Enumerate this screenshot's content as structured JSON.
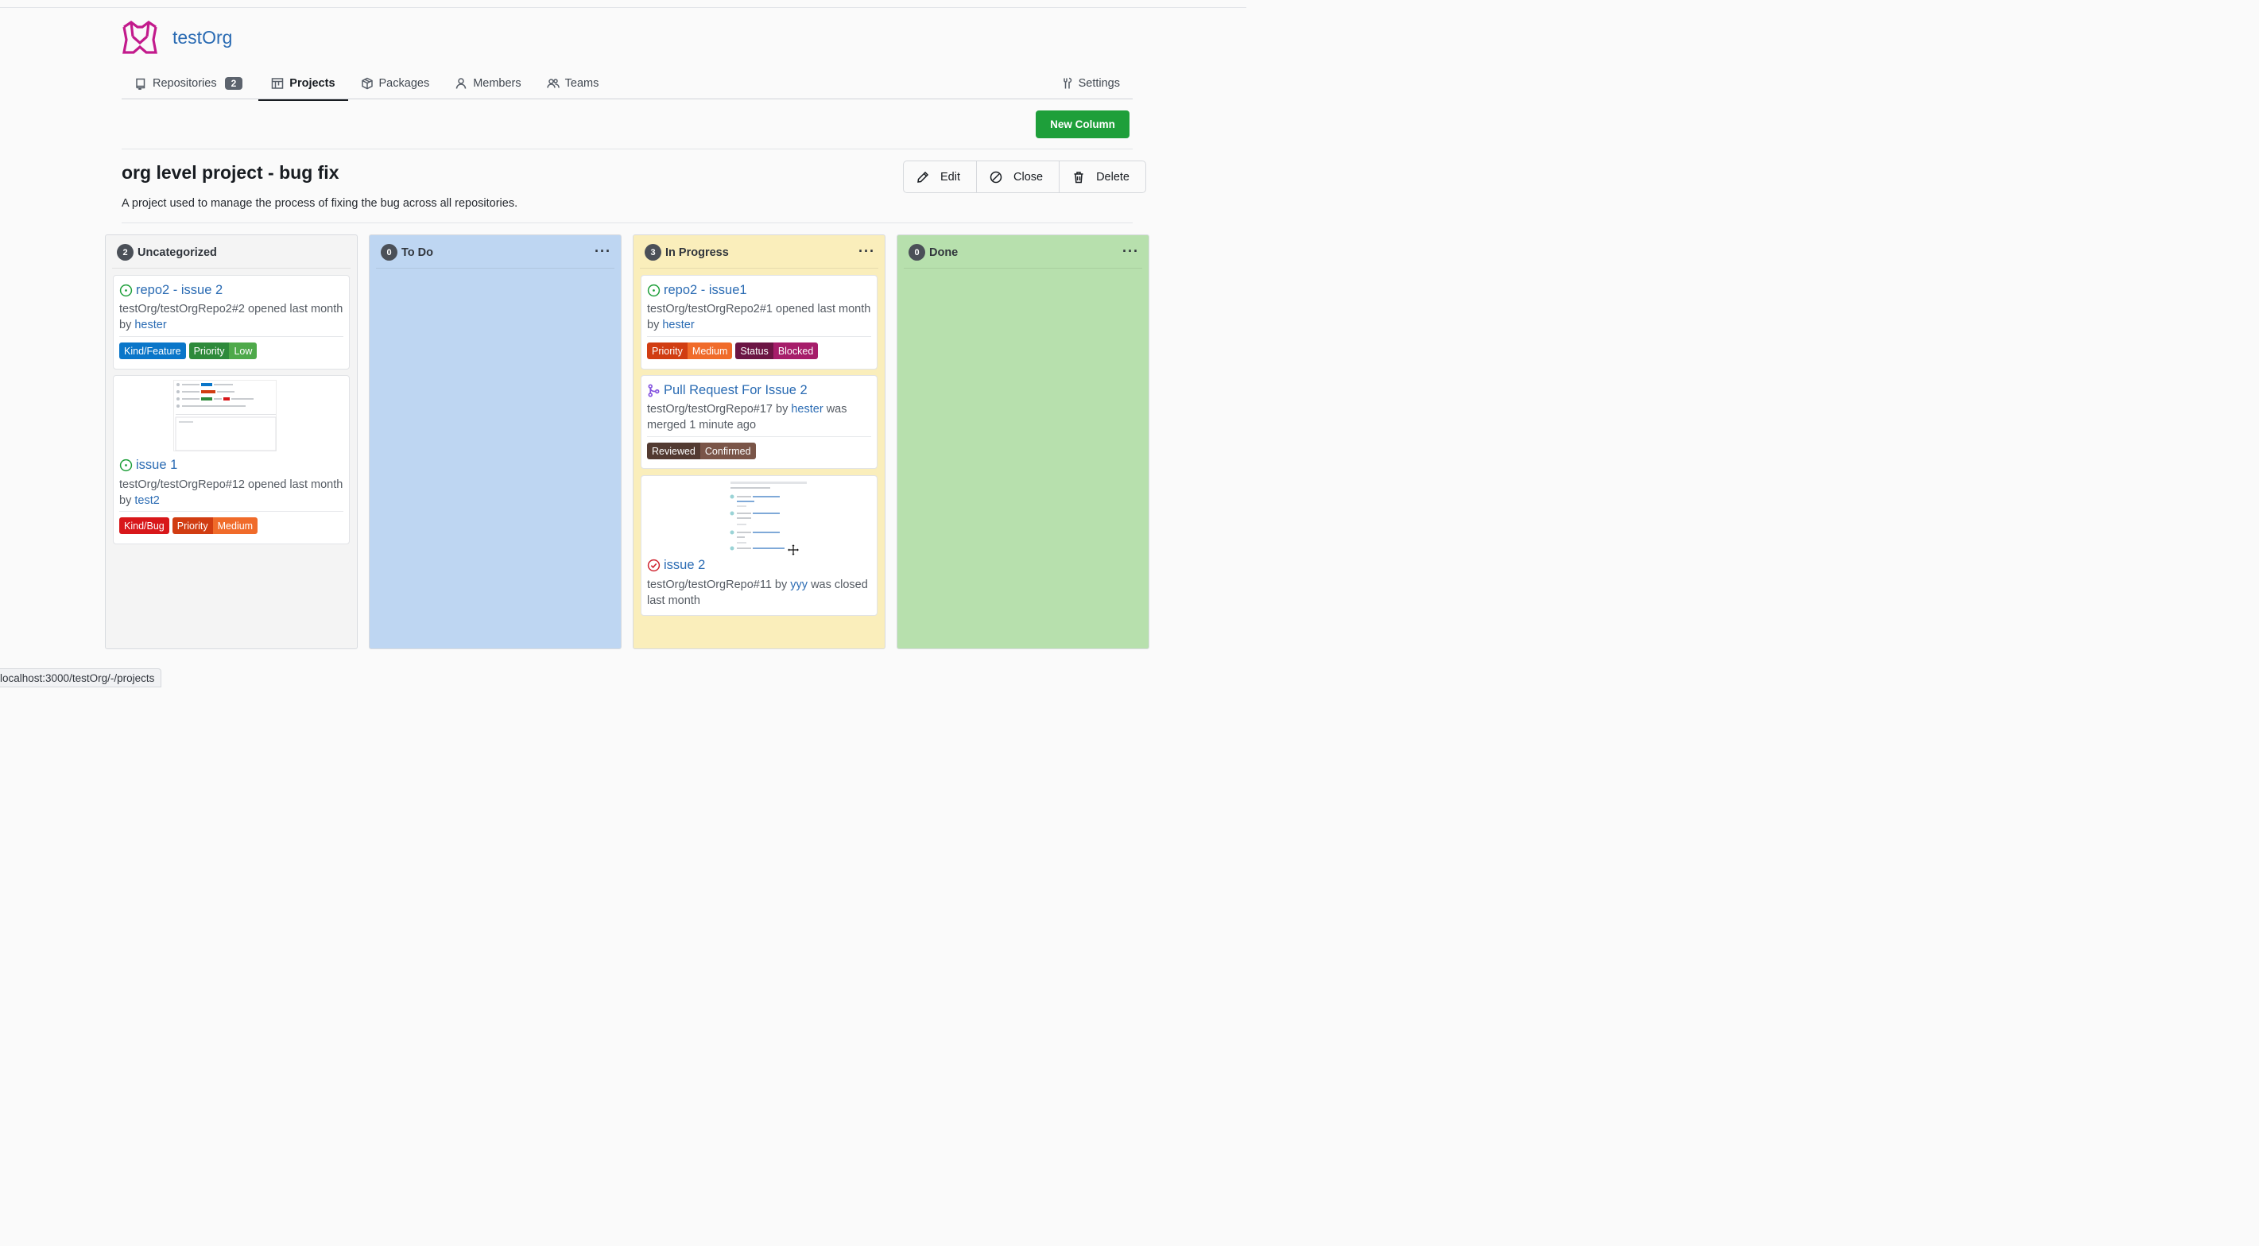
{
  "org": {
    "name": "testOrg"
  },
  "tabs": [
    {
      "label": "Repositories",
      "count": "2"
    },
    {
      "label": "Projects"
    },
    {
      "label": "Packages"
    },
    {
      "label": "Members"
    },
    {
      "label": "Teams"
    },
    {
      "label": "Settings"
    }
  ],
  "toolbar": {
    "new_column_label": "New Column"
  },
  "project": {
    "title": "org level project - bug fix",
    "description": "A project used to manage the process of fixing the bug across all repositories.",
    "actions": {
      "edit": "Edit",
      "close": "Close",
      "delete": "Delete"
    }
  },
  "columns": [
    {
      "title": "Uncategorized",
      "count": "2",
      "bg": "#f4f4f4",
      "cards": [
        {
          "title": "repo2 - issue 2",
          "status": "open",
          "meta_prefix": "testOrg/testOrgRepo2#2 opened last month by",
          "meta_user": "hester",
          "meta_suffix": "",
          "labels": [
            {
              "scope": "Kind/Feature",
              "scope_color": "#0a76c9"
            },
            {
              "scope": "Priority",
              "value": "Low",
              "scope_color": "#2e8a3b",
              "value_color": "#4ea94a"
            }
          ]
        },
        {
          "title": "issue 1",
          "status": "open",
          "meta_prefix": "testOrg/testOrgRepo#12 opened last month by",
          "meta_user": "test2",
          "meta_suffix": "",
          "labels": [
            {
              "scope": "Kind/Bug",
              "scope_color": "#d8171a"
            },
            {
              "scope": "Priority",
              "value": "Medium",
              "scope_color": "#d13d12",
              "value_color": "#f06b2a"
            }
          ]
        }
      ]
    },
    {
      "title": "To Do",
      "count": "0",
      "bg": "#bed6f2",
      "cards": []
    },
    {
      "title": "In Progress",
      "count": "3",
      "bg": "#faeebb",
      "cards": [
        {
          "title": "repo2 - issue1",
          "status": "open",
          "meta_prefix": "testOrg/testOrgRepo2#1 opened last month by",
          "meta_user": "hester",
          "meta_suffix": "",
          "labels": [
            {
              "scope": "Priority",
              "value": "Medium",
              "scope_color": "#d13d12",
              "value_color": "#f06b2a"
            },
            {
              "scope": "Status",
              "value": "Blocked",
              "scope_color": "#6c1544",
              "value_color": "#a61d6a"
            }
          ]
        },
        {
          "title": "Pull Request For Issue 2",
          "status": "merged",
          "meta_prefix": "testOrg/testOrgRepo#17 by",
          "meta_user": "hester",
          "meta_suffix": "was merged 1 minute ago",
          "labels": [
            {
              "scope": "Reviewed",
              "value": "Confirmed",
              "scope_color": "#523a31",
              "value_color": "#7a5548"
            }
          ]
        },
        {
          "title": "issue 2",
          "status": "closed",
          "meta_prefix": "testOrg/testOrgRepo#11 by",
          "meta_user": "yyy",
          "meta_suffix": "was closed last month",
          "labels": []
        }
      ]
    },
    {
      "title": "Done",
      "count": "0",
      "bg": "#b7e0ad",
      "cards": []
    }
  ],
  "status_bar": {
    "url": "localhost:3000/testOrg/-/projects"
  },
  "icons": {
    "open": "issue-opened-icon",
    "closed": "issue-closed-icon",
    "merged": "pull-request-merged-icon",
    "column_menu": "kebab-horizontal-icon"
  },
  "colors": {
    "link": "#2a6bb3",
    "primary_button": "#1e9f3a",
    "open": "#1e9f3a",
    "closed": "#cf222e",
    "merged": "#8250df"
  }
}
